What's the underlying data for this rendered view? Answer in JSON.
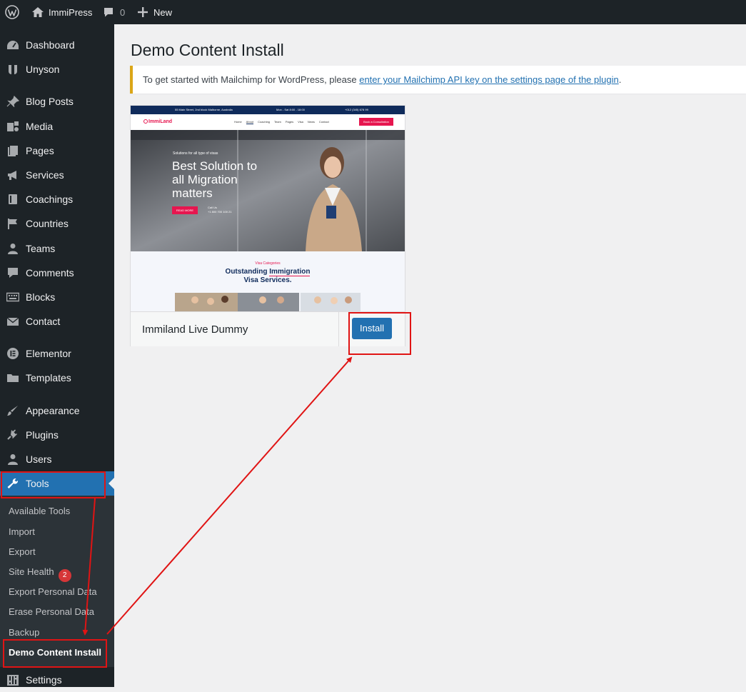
{
  "admin_bar": {
    "site_name": "ImmiPress",
    "comments_count": "0",
    "new_label": "New"
  },
  "sidebar": {
    "items": [
      {
        "label": "Dashboard",
        "icon": "dashboard-icon"
      },
      {
        "label": "Unyson",
        "icon": "unyson-icon"
      },
      {
        "label": "Blog Posts",
        "icon": "pin-icon"
      },
      {
        "label": "Media",
        "icon": "media-icon"
      },
      {
        "label": "Pages",
        "icon": "pages-icon"
      },
      {
        "label": "Services",
        "icon": "megaphone-icon"
      },
      {
        "label": "Coachings",
        "icon": "book-icon"
      },
      {
        "label": "Countries",
        "icon": "flag-icon"
      },
      {
        "label": "Teams",
        "icon": "user-icon"
      },
      {
        "label": "Comments",
        "icon": "comment-icon"
      },
      {
        "label": "Blocks",
        "icon": "keyboard-icon"
      },
      {
        "label": "Contact",
        "icon": "email-icon"
      },
      {
        "label": "Elementor",
        "icon": "elementor-icon"
      },
      {
        "label": "Templates",
        "icon": "folder-icon"
      },
      {
        "label": "Appearance",
        "icon": "paintbrush-icon"
      },
      {
        "label": "Plugins",
        "icon": "plugin-icon"
      },
      {
        "label": "Users",
        "icon": "users-icon"
      },
      {
        "label": "Tools",
        "icon": "wrench-icon"
      },
      {
        "label": "Settings",
        "icon": "settings-icon"
      }
    ],
    "tools_submenu": [
      {
        "label": "Available Tools"
      },
      {
        "label": "Import"
      },
      {
        "label": "Export"
      },
      {
        "label": "Site Health",
        "badge": "2"
      },
      {
        "label": "Export Personal Data"
      },
      {
        "label": "Erase Personal Data"
      },
      {
        "label": "Backup"
      },
      {
        "label": "Demo Content Install"
      }
    ]
  },
  "main": {
    "title": "Demo Content Install",
    "notice": {
      "text": "To get started with Mailchimp for WordPress, please ",
      "link": "enter your Mailchimp API key on the settings page of the plugin",
      "suffix": "."
    },
    "demo": {
      "name": "Immiland Live Dummy",
      "install_label": "Install",
      "preview": {
        "address": "55 Main Street, 2nd block Malborne, Australia",
        "hours": "Mon - Sat 8:00 - 18:00",
        "phone": "+012 (345) 678 99",
        "logo": "ImmiLand",
        "nav": [
          "Home",
          "About",
          "Coaching",
          "Team",
          "Pages",
          "Visa",
          "News",
          "Contact"
        ],
        "cta": "Book a Consultation",
        "eyebrow": "Solutions for all type of visas",
        "headline": [
          "Best Solution to",
          "all Migration",
          "matters"
        ],
        "read_more": "READ MORE",
        "call_label": "Call Us",
        "call_number": "+1 800 700 100 21",
        "section_tag": "Visa Categories",
        "section_title_1": "Outstanding ",
        "section_title_highlight": "Immigration",
        "section_title_2": "Visa Services."
      }
    }
  },
  "colors": {
    "admin_dark": "#1d2327",
    "accent": "#2271b1",
    "annotation": "#e01414",
    "notice_border": "#dba617",
    "badge": "#d63638"
  }
}
